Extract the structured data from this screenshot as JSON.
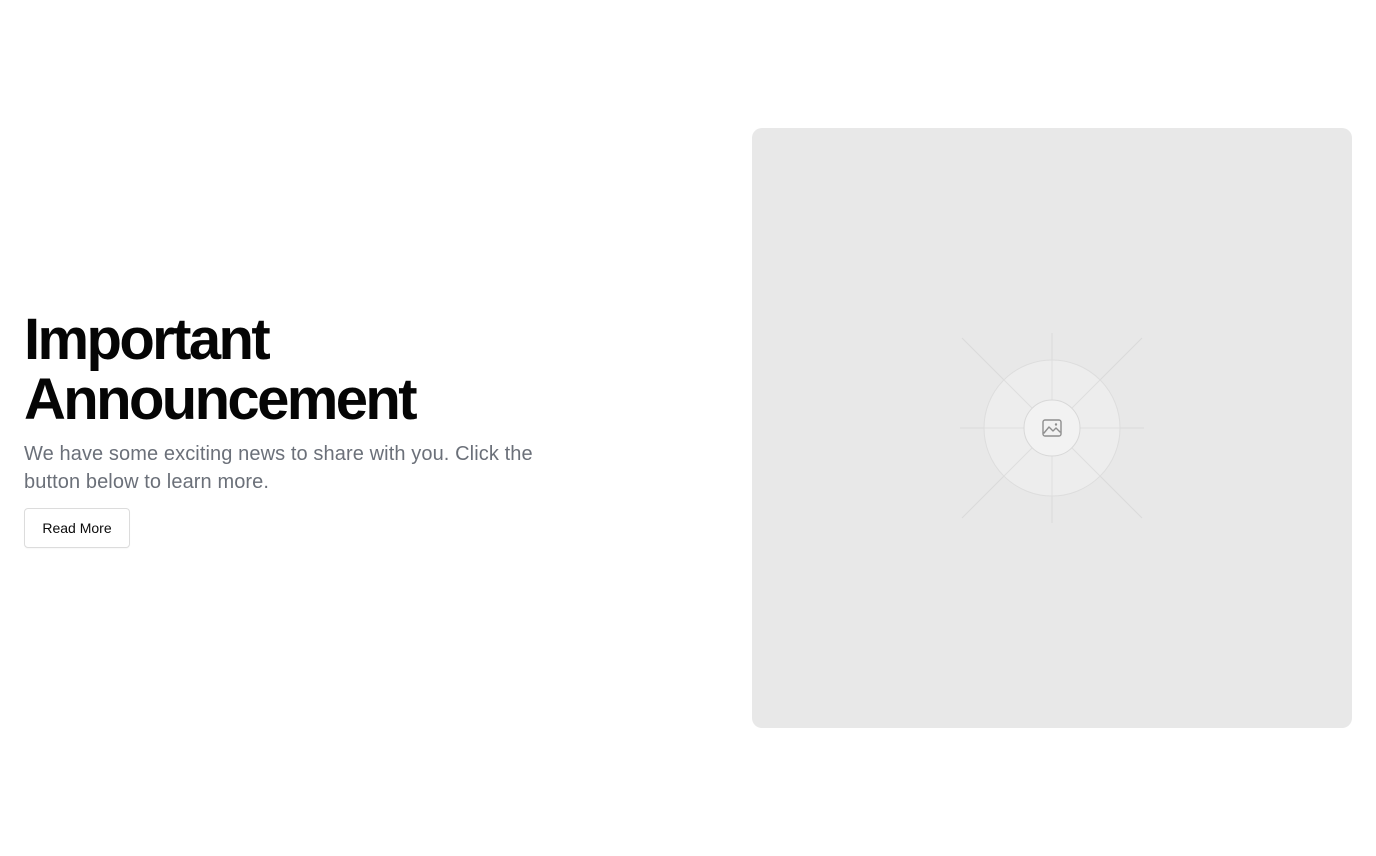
{
  "hero": {
    "title_line1": "Important",
    "title_line2": "Announcement",
    "subtitle": "We have some exciting news to share with you. Click the button below to learn more.",
    "cta_label": "Read More"
  },
  "media": {
    "icon": "image-placeholder-icon"
  },
  "colors": {
    "background": "#ffffff",
    "title": "#050505",
    "subtitle": "#6b7079",
    "button_border": "#dcdcdc",
    "placeholder_bg": "#e8e8e8"
  }
}
